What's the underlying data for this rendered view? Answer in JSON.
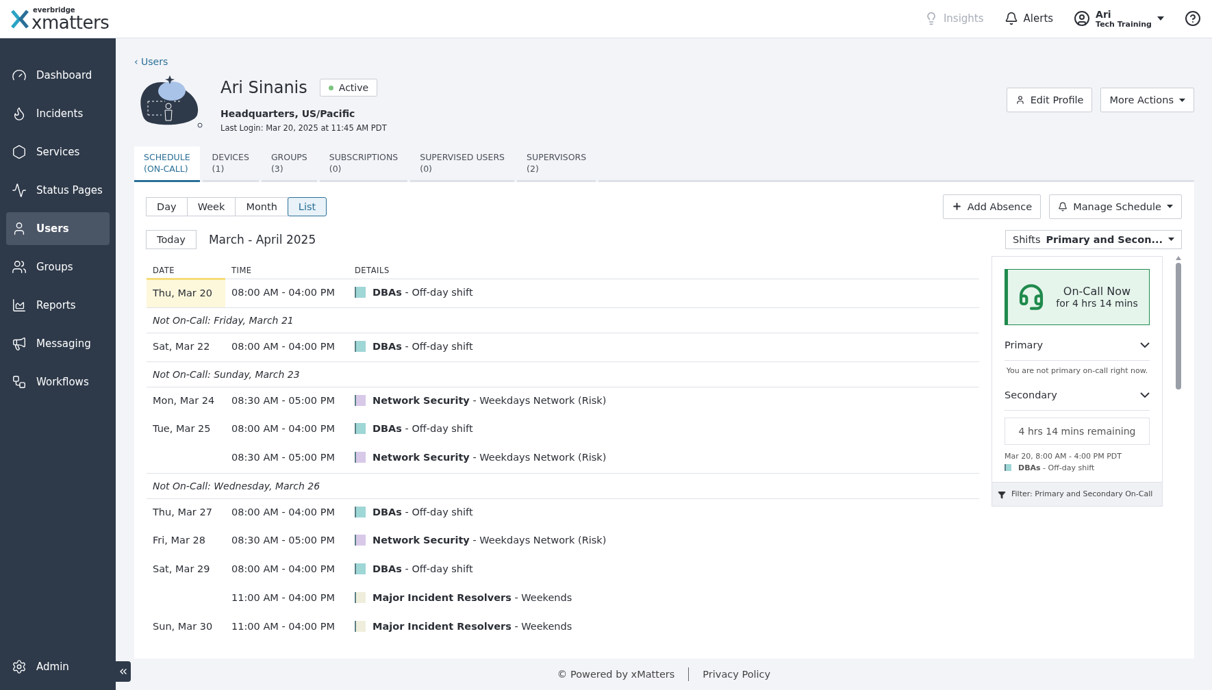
{
  "brand": {
    "top": "everbridge",
    "name": "xmatters"
  },
  "topbar": {
    "insights": "Insights",
    "alerts": "Alerts",
    "user_name": "Ari",
    "user_org": "Tech Training"
  },
  "sidebar": {
    "items": [
      {
        "label": "Dashboard",
        "selected": false
      },
      {
        "label": "Incidents",
        "selected": false
      },
      {
        "label": "Services",
        "selected": false
      },
      {
        "label": "Status Pages",
        "selected": false
      },
      {
        "label": "Users",
        "selected": true
      },
      {
        "label": "Groups",
        "selected": false
      },
      {
        "label": "Reports",
        "selected": false
      },
      {
        "label": "Messaging",
        "selected": false
      },
      {
        "label": "Workflows",
        "selected": false
      }
    ],
    "admin": "Admin"
  },
  "breadcrumb": "‹ Users",
  "profile": {
    "name": "Ari Sinanis",
    "status": "Active",
    "location": "Headquarters, US/Pacific",
    "last_login": "Last Login: Mar 20, 2025 at 11:45 AM PDT",
    "actions": [
      "Edit Profile",
      "More Actions"
    ]
  },
  "tabs": [
    {
      "label": "SCHEDULE",
      "count": "(ON-CALL)",
      "selected": true
    },
    {
      "label": "DEVICES",
      "count": "(1)",
      "selected": false
    },
    {
      "label": "GROUPS",
      "count": "(3)",
      "selected": false
    },
    {
      "label": "SUBSCRIPTIONS",
      "count": "(0)",
      "selected": false
    },
    {
      "label": "SUPERVISED USERS",
      "count": "(0)",
      "selected": false
    },
    {
      "label": "SUPERVISORS",
      "count": "(2)",
      "selected": false
    }
  ],
  "views": [
    {
      "label": "Day",
      "selected": false
    },
    {
      "label": "Week",
      "selected": false
    },
    {
      "label": "Month",
      "selected": false
    },
    {
      "label": "List",
      "selected": true
    }
  ],
  "schedule_actions": [
    "Add Absence",
    "Manage Schedule"
  ],
  "today_button": "Today",
  "range": "March - April 2025",
  "shifts_filter": {
    "label": "Shifts",
    "value": "Primary and Secon..."
  },
  "table": {
    "columns": [
      "DATE",
      "TIME",
      "DETAILS"
    ],
    "rows": [
      {
        "kind": "entry",
        "date": "Thu, Mar 20",
        "today": true,
        "time": "08:00 AM - 04:00 PM",
        "details": "**DBAs** - Off-day shift",
        "color": "#9fd6d6"
      },
      {
        "kind": "gap",
        "text": "Not On-Call: Friday, March 21"
      },
      {
        "kind": "entry",
        "date": "Sat, Mar 22",
        "today": false,
        "time": "08:00 AM - 04:00 PM",
        "details": "**DBAs** - Off-day shift",
        "color": "#9fd6d6"
      },
      {
        "kind": "gap",
        "text": "Not On-Call: Sunday, March 23"
      },
      {
        "kind": "entry",
        "date": "Mon, Mar 24",
        "today": false,
        "time": "08:30 AM - 05:00 PM",
        "details": "**Network Security** - Weekdays Network (Risk)",
        "color": "#d8c9e9"
      },
      {
        "kind": "entry",
        "date": "Tue, Mar 25",
        "today": false,
        "time": "08:00 AM - 04:00 PM",
        "details": "**DBAs** - Off-day shift",
        "color": "#9fd6d6"
      },
      {
        "kind": "entry",
        "time": "08:30 AM - 05:00 PM",
        "details": "**Network Security** - Weekdays Network (Risk)",
        "color": "#d8c9e9"
      },
      {
        "kind": "gap",
        "text": "Not On-Call: Wednesday, March 26"
      },
      {
        "kind": "entry",
        "date": "Thu, Mar 27",
        "today": false,
        "time": "08:00 AM - 04:00 PM",
        "details": "**DBAs** - Off-day shift",
        "color": "#9fd6d6"
      },
      {
        "kind": "entry",
        "date": "Fri, Mar 28",
        "today": false,
        "time": "08:30 AM - 05:00 PM",
        "details": "**Network Security** - Weekdays Network (Risk)",
        "color": "#d8c9e9"
      },
      {
        "kind": "entry",
        "date": "Sat, Mar 29",
        "today": false,
        "time": "08:00 AM - 04:00 PM",
        "details": "**DBAs** - Off-day shift",
        "color": "#9fd6d6"
      },
      {
        "kind": "entry",
        "time": "11:00 AM - 04:00 PM",
        "details": "**Major Incident Resolvers** - Weekends",
        "color": "#efeedc"
      },
      {
        "kind": "entry",
        "date": "Sun, Mar 30",
        "today": false,
        "time": "11:00 AM - 04:00 PM",
        "details": "**Major Incident Resolvers** - Weekends",
        "color": "#efeedc"
      }
    ]
  },
  "oncall": {
    "title": "On-Call Now",
    "duration": "for 4 hrs 14 mins",
    "sections": [
      {
        "label": "Primary",
        "expanded": true
      },
      {
        "label": "Secondary",
        "expanded": true
      }
    ],
    "primary_note": "You are not primary on-call right now.",
    "remaining": "4 hrs 14 mins remaining",
    "shift_time": "Mar 20, 8:00 AM - 4:00 PM PDT",
    "shift": {
      "details": "**DBAs** - Off-day shift",
      "color": "#9fd6d6"
    },
    "filter": "Filter: Primary and Secondary On-Call"
  },
  "footer": {
    "powered": "© Powered by xMatters",
    "privacy": "Privacy Policy"
  }
}
